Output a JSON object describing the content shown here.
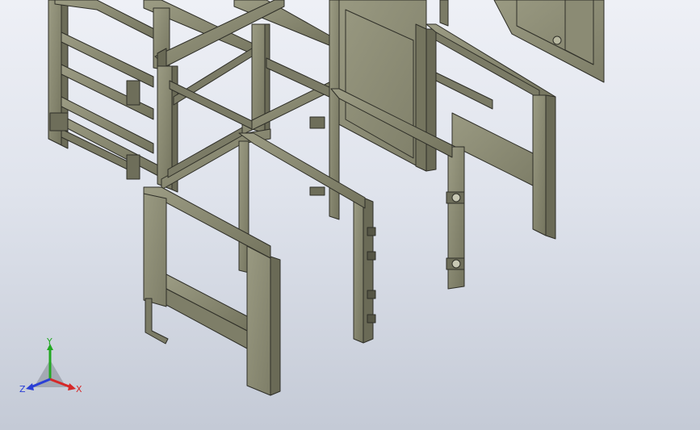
{
  "viewport": {
    "background_top": "#eef0f6",
    "background_bottom": "#c4cad6",
    "part_color": "#8a8a72",
    "part_edge_color": "#2f2f28"
  },
  "triad": {
    "x_label": "X",
    "y_label": "Y",
    "z_label": "Z",
    "x_color": "#d62828",
    "y_color": "#22a822",
    "z_color": "#2a3fd6"
  }
}
